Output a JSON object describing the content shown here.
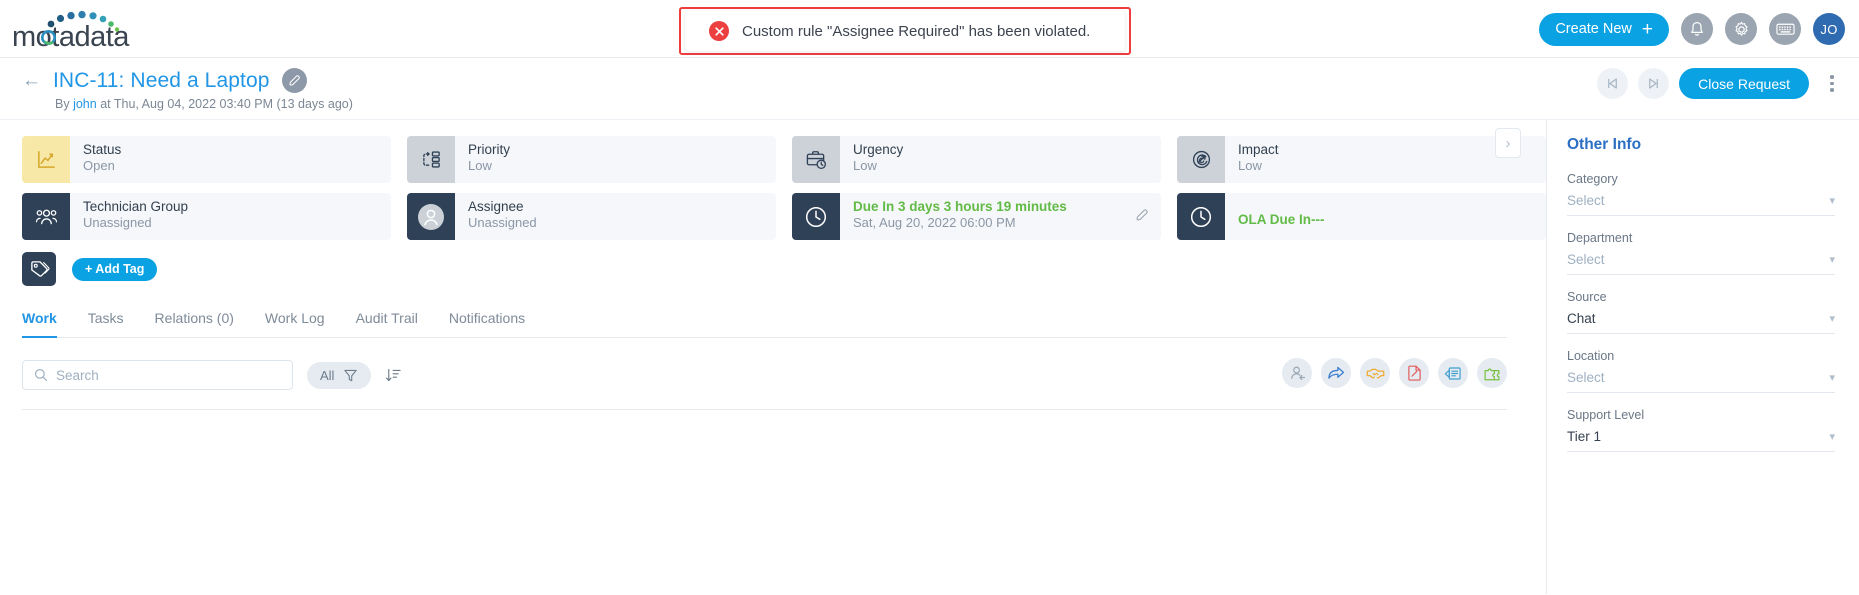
{
  "app": {
    "logo_text": "motadata",
    "brand_color": "#0aa2e3"
  },
  "toast": {
    "icon": "error-circle-icon",
    "message": "Custom rule \"Assignee Required\" has been violated.",
    "border_color": "#ef3d3d",
    "icon_color": "#ec4040"
  },
  "topbar": {
    "create_new_label": "Create New",
    "plus_glyph": "+",
    "notification_icon": "bell-icon",
    "settings_icon": "gear-icon",
    "keyboard_icon": "keyboard-icon",
    "avatar_initials": "JO"
  },
  "subheader": {
    "back_icon": "back-arrow-icon",
    "title": "INC-11: Need a Laptop",
    "edit_icon": "pencil-icon",
    "byline_prefix": "By",
    "byline_user": "john",
    "byline_rest": "at Thu, Aug 04, 2022 03:40 PM (13 days ago)",
    "prev_icon": "skip-previous-icon",
    "next_icon": "skip-next-icon",
    "close_request_label": "Close Request",
    "more_icon": "kebab-menu-icon"
  },
  "cards": {
    "chevron_icon": "chevron-right-icon",
    "row1": [
      {
        "icon": "chart-line-icon",
        "icon_style": "yellow",
        "label": "Status",
        "value": "Open"
      },
      {
        "icon": "priority-flow-icon",
        "icon_style": "grey",
        "label": "Priority",
        "value": "Low"
      },
      {
        "icon": "briefcase-clock-icon",
        "icon_style": "grey",
        "label": "Urgency",
        "value": "Low"
      },
      {
        "icon": "target-impact-icon",
        "icon_style": "grey",
        "label": "Impact",
        "value": "Low"
      }
    ],
    "row2": [
      {
        "icon": "people-group-icon",
        "icon_style": "dark",
        "label": "Technician Group",
        "value": "Unassigned"
      },
      {
        "icon": "user-avatar-icon",
        "icon_style": "dark",
        "label": "Assignee",
        "value": "Unassigned"
      },
      {
        "icon": "clock-icon",
        "icon_style": "dark",
        "label": "Due In 3 days 3 hours 19 minutes",
        "value": "Sat, Aug 20, 2022 06:00 PM",
        "label_green": true,
        "has_pencil": true
      },
      {
        "icon": "clock-icon",
        "icon_style": "dark",
        "label": "OLA Due In---",
        "value": "",
        "label_green": true
      }
    ]
  },
  "tags": {
    "icon": "tag-icon",
    "add_tag_label": "+ Add Tag"
  },
  "tabs": [
    {
      "label": "Work",
      "active": true
    },
    {
      "label": "Tasks",
      "active": false
    },
    {
      "label": "Relations (0)",
      "active": false
    },
    {
      "label": "Work Log",
      "active": false
    },
    {
      "label": "Audit Trail",
      "active": false
    },
    {
      "label": "Notifications",
      "active": false
    }
  ],
  "toolbar": {
    "search_placeholder": "Search",
    "search_value": "",
    "search_icon": "search-icon",
    "filter_label": "All",
    "filter_icon": "funnel-icon",
    "sort_icon": "sort-descending-icon",
    "actions": [
      {
        "icon": "assign-user-icon",
        "color": "#9aa5b1"
      },
      {
        "icon": "forward-arrow-icon",
        "color": "#3f7fd0"
      },
      {
        "icon": "handshake-icon",
        "color": "#f0a92c"
      },
      {
        "icon": "document-edit-icon",
        "color": "#e05b5b"
      },
      {
        "icon": "note-edit-icon",
        "color": "#3f9fd0"
      },
      {
        "icon": "puzzle-piece-icon",
        "color": "#7ac143"
      }
    ]
  },
  "sidebar": {
    "title": "Other Info",
    "fields": [
      {
        "label": "Category",
        "value": "Select",
        "placeholder": true
      },
      {
        "label": "Department",
        "value": "Select",
        "placeholder": true
      },
      {
        "label": "Source",
        "value": "Chat",
        "placeholder": false
      },
      {
        "label": "Location",
        "value": "Select",
        "placeholder": true
      },
      {
        "label": "Support Level",
        "value": "Tier 1",
        "placeholder": false
      }
    ],
    "chevron_icon": "chevron-down-icon"
  }
}
